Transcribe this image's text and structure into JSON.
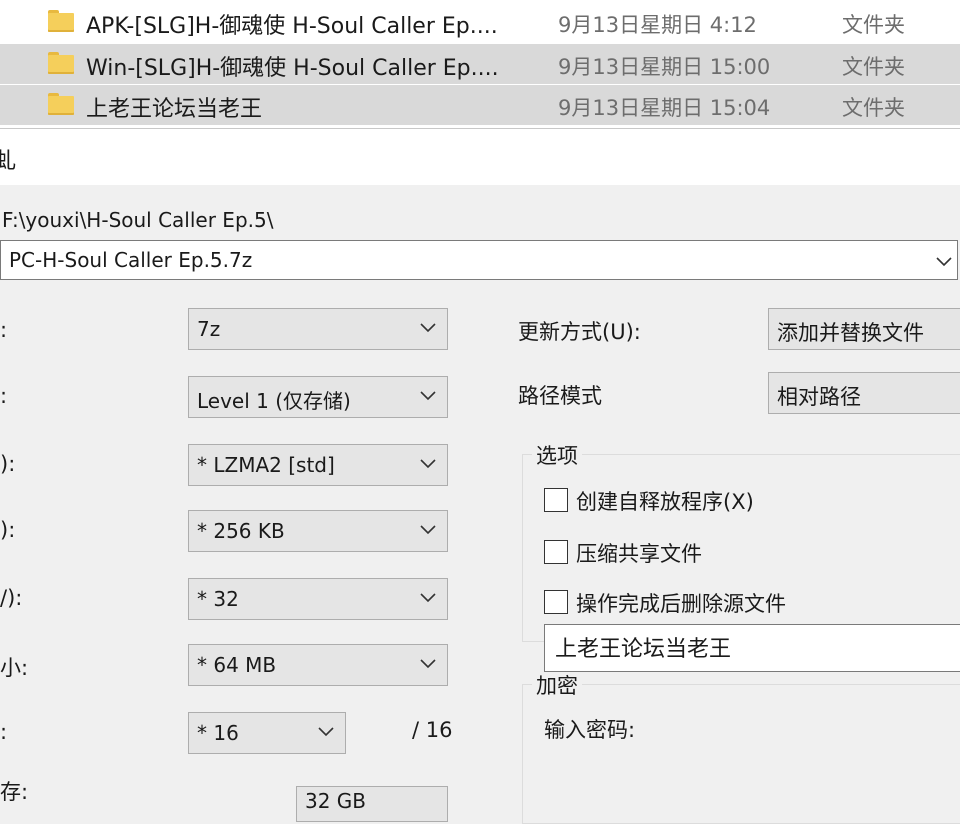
{
  "explorer": {
    "rows": [
      {
        "name": "APK-[SLG]H-御魂使  H-Soul Caller Ep....",
        "date": "9月13日星期日 4:12",
        "type": "文件夹"
      },
      {
        "name": "Win-[SLG]H-御魂使  H-Soul Caller Ep....",
        "date": "9月13日星期日 15:00",
        "type": "文件夹"
      },
      {
        "name": "上老王论坛当老王",
        "date": "9月13日星期日 15:04",
        "type": "文件夹"
      }
    ]
  },
  "dialog": {
    "title_fragment": "虬",
    "archive_path": "F:\\youxi\\H-Soul Caller Ep.5\\",
    "archive_name": "PC-H-Soul Caller Ep.5.7z",
    "left_labels": [
      ":",
      ":",
      "):",
      "):",
      "/):",
      "小:",
      ":",
      "存:"
    ],
    "format": "7z",
    "level": "Level 1 (仅存储)",
    "method": "* LZMA2 [std]",
    "dictionary": "* 256 KB",
    "word_size": "* 32",
    "solid_block": "* 64 MB",
    "threads": "* 16",
    "threads_total": "/ 16",
    "memory": "32 GB",
    "update_mode_label": "更新方式(U):",
    "update_mode_value": "添加并替换文件",
    "path_mode_label": "路径模式",
    "path_mode_value": "相对路径",
    "options": {
      "title": "选项",
      "items": [
        "创建自释放程序(X)",
        "压缩共享文件",
        "操作完成后删除源文件"
      ]
    },
    "encryption": {
      "title": "加密",
      "password_label": "输入密码:",
      "password_value": "上老王论坛当老王"
    }
  }
}
